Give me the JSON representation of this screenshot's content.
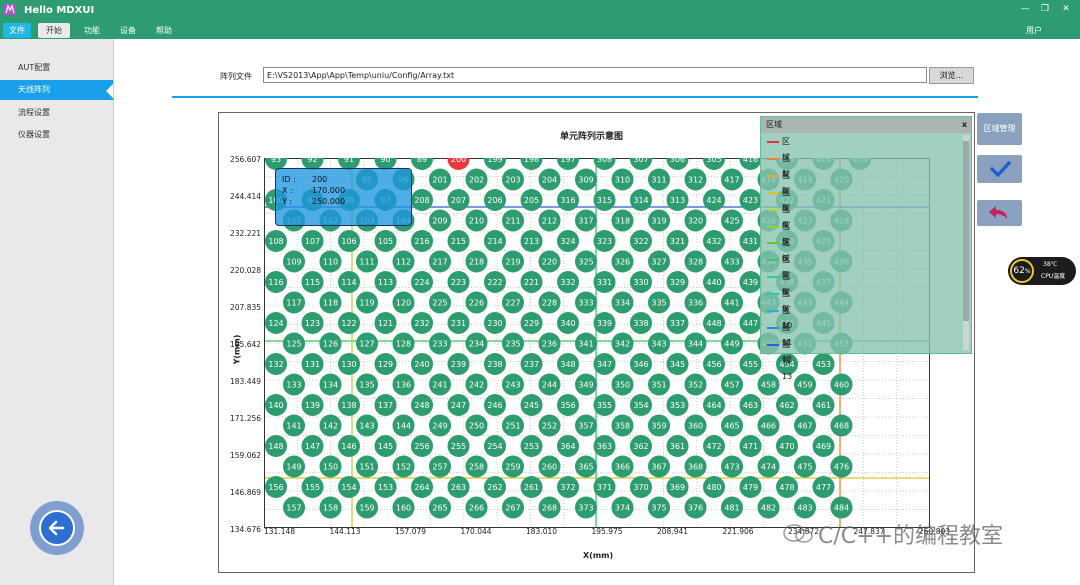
{
  "app": {
    "title": "Hello MDXUI",
    "window_controls": [
      "—",
      "❐",
      "✕"
    ],
    "user_label": "用户"
  },
  "menu": [
    {
      "label": "文件"
    },
    {
      "label": "开始"
    },
    {
      "label": "功能"
    },
    {
      "label": "设备"
    },
    {
      "label": "帮助"
    }
  ],
  "sidebar": {
    "items": [
      {
        "label": "AUT配置"
      },
      {
        "label": "天线阵列"
      },
      {
        "label": "流程设置"
      },
      {
        "label": "仪器设置"
      }
    ],
    "active_index": 1
  },
  "file": {
    "label": "阵列文件",
    "path": "E:\\VS2013\\App\\App\\Temp\\uniu/Config/Array.txt",
    "browse_label": "浏览..."
  },
  "chart": {
    "title": "单元阵列示意图",
    "xlabel": "X(mm)",
    "ylabel": "Y(mm)",
    "y_ticks": [
      "256.607",
      "244.414",
      "232.221",
      "220.028",
      "207.835",
      "195.642",
      "183.449",
      "171.256",
      "159.062",
      "146.869",
      "134.676"
    ],
    "x_ticks": [
      "131.148",
      "144.113",
      "157.079",
      "170.044",
      "183.010",
      "195.975",
      "208.941",
      "221.906",
      "234.872",
      "247.837",
      "260.803"
    ]
  },
  "chart_data": {
    "type": "scatter",
    "title": "单元阵列示意图",
    "xlabel": "X(mm)",
    "ylabel": "Y(mm)",
    "xlim": [
      131.148,
      260.803
    ],
    "ylim": [
      134.676,
      256.607
    ],
    "visible_rows": [
      [
        93,
        92,
        91,
        90,
        89,
        200,
        199,
        198,
        197,
        308,
        307,
        306,
        305,
        416,
        415,
        414,
        413
      ],
      [
        95,
        96,
        201,
        202,
        203,
        204,
        309,
        310,
        311,
        312,
        417,
        418,
        419,
        420
      ],
      [
        100,
        99,
        98,
        97,
        208,
        207,
        206,
        205,
        316,
        315,
        314,
        313,
        424,
        423,
        422,
        421
      ],
      [
        101,
        102,
        103,
        104,
        209,
        210,
        211,
        212,
        317,
        318,
        319,
        320,
        425,
        426,
        427,
        428
      ],
      [
        108,
        107,
        106,
        105,
        216,
        215,
        214,
        213,
        324,
        323,
        322,
        321,
        432,
        431,
        430,
        429
      ],
      [
        109,
        110,
        111,
        112,
        217,
        218,
        219,
        220,
        325,
        326,
        327,
        328,
        433,
        434,
        435,
        436
      ],
      [
        116,
        115,
        114,
        113,
        224,
        223,
        222,
        221,
        332,
        331,
        330,
        329,
        440,
        439,
        438,
        437
      ],
      [
        117,
        118,
        119,
        120,
        225,
        226,
        227,
        228,
        333,
        334,
        335,
        336,
        441,
        442,
        443,
        444
      ],
      [
        124,
        123,
        122,
        121,
        232,
        231,
        230,
        229,
        340,
        339,
        338,
        337,
        448,
        447,
        446,
        445
      ],
      [
        125,
        126,
        127,
        128,
        233,
        234,
        235,
        236,
        341,
        342,
        343,
        344,
        449,
        450,
        451,
        452
      ],
      [
        132,
        131,
        130,
        129,
        240,
        239,
        238,
        237,
        348,
        347,
        346,
        345,
        456,
        455,
        454,
        453
      ],
      [
        133,
        134,
        135,
        136,
        241,
        242,
        243,
        244,
        349,
        350,
        351,
        352,
        457,
        458,
        459,
        460
      ],
      [
        140,
        139,
        138,
        137,
        248,
        247,
        246,
        245,
        356,
        355,
        354,
        353,
        464,
        463,
        462,
        461
      ],
      [
        141,
        142,
        143,
        144,
        249,
        250,
        251,
        252,
        357,
        358,
        359,
        360,
        465,
        466,
        467,
        468
      ],
      [
        148,
        147,
        146,
        145,
        256,
        255,
        254,
        253,
        364,
        363,
        362,
        361,
        472,
        471,
        470,
        469
      ],
      [
        149,
        150,
        151,
        152,
        257,
        258,
        259,
        260,
        365,
        366,
        367,
        368,
        473,
        474,
        475,
        476
      ],
      [
        156,
        155,
        154,
        153,
        264,
        263,
        262,
        261,
        372,
        371,
        370,
        369,
        480,
        479,
        478,
        477
      ],
      [
        157,
        158,
        159,
        160,
        265,
        266,
        267,
        268,
        373,
        374,
        375,
        376,
        481,
        482,
        483,
        484
      ]
    ],
    "highlighted_element": 200
  },
  "tooltip": {
    "rows": [
      {
        "key": "ID :",
        "value": "200"
      },
      {
        "key": "X :",
        "value": "170.000"
      },
      {
        "key": "Y :",
        "value": "250.000"
      }
    ]
  },
  "regions": {
    "title": "区域",
    "close": "x",
    "items": [
      {
        "label": "区域1",
        "color": "#d83b3b"
      },
      {
        "label": "区域2",
        "color": "#e8842a"
      },
      {
        "label": "区域3",
        "color": "#e3a832"
      },
      {
        "label": "区域4",
        "color": "#d8c42a"
      },
      {
        "label": "区域5",
        "color": "#b6d630"
      },
      {
        "label": "区域6",
        "color": "#8cd33a"
      },
      {
        "label": "区域7",
        "color": "#5cc83c"
      },
      {
        "label": "区域8",
        "color": "#3cc85a"
      },
      {
        "label": "区域9",
        "color": "#38c88c"
      },
      {
        "label": "区域10",
        "color": "#2fc4b8"
      },
      {
        "label": "区域11",
        "color": "#2fb0d8"
      },
      {
        "label": "区域12",
        "color": "#2f86d8"
      },
      {
        "label": "区域13",
        "color": "#2f5cd8"
      }
    ]
  },
  "toolbar": {
    "region_manage_label": "区域管理",
    "confirm_icon": "check-icon",
    "undo_icon": "undo-icon"
  },
  "cpu": {
    "percent": "62",
    "percent_unit": "%",
    "temp": "38℃",
    "label": "CPU温度"
  },
  "watermark": "C/C++的编程教室"
}
